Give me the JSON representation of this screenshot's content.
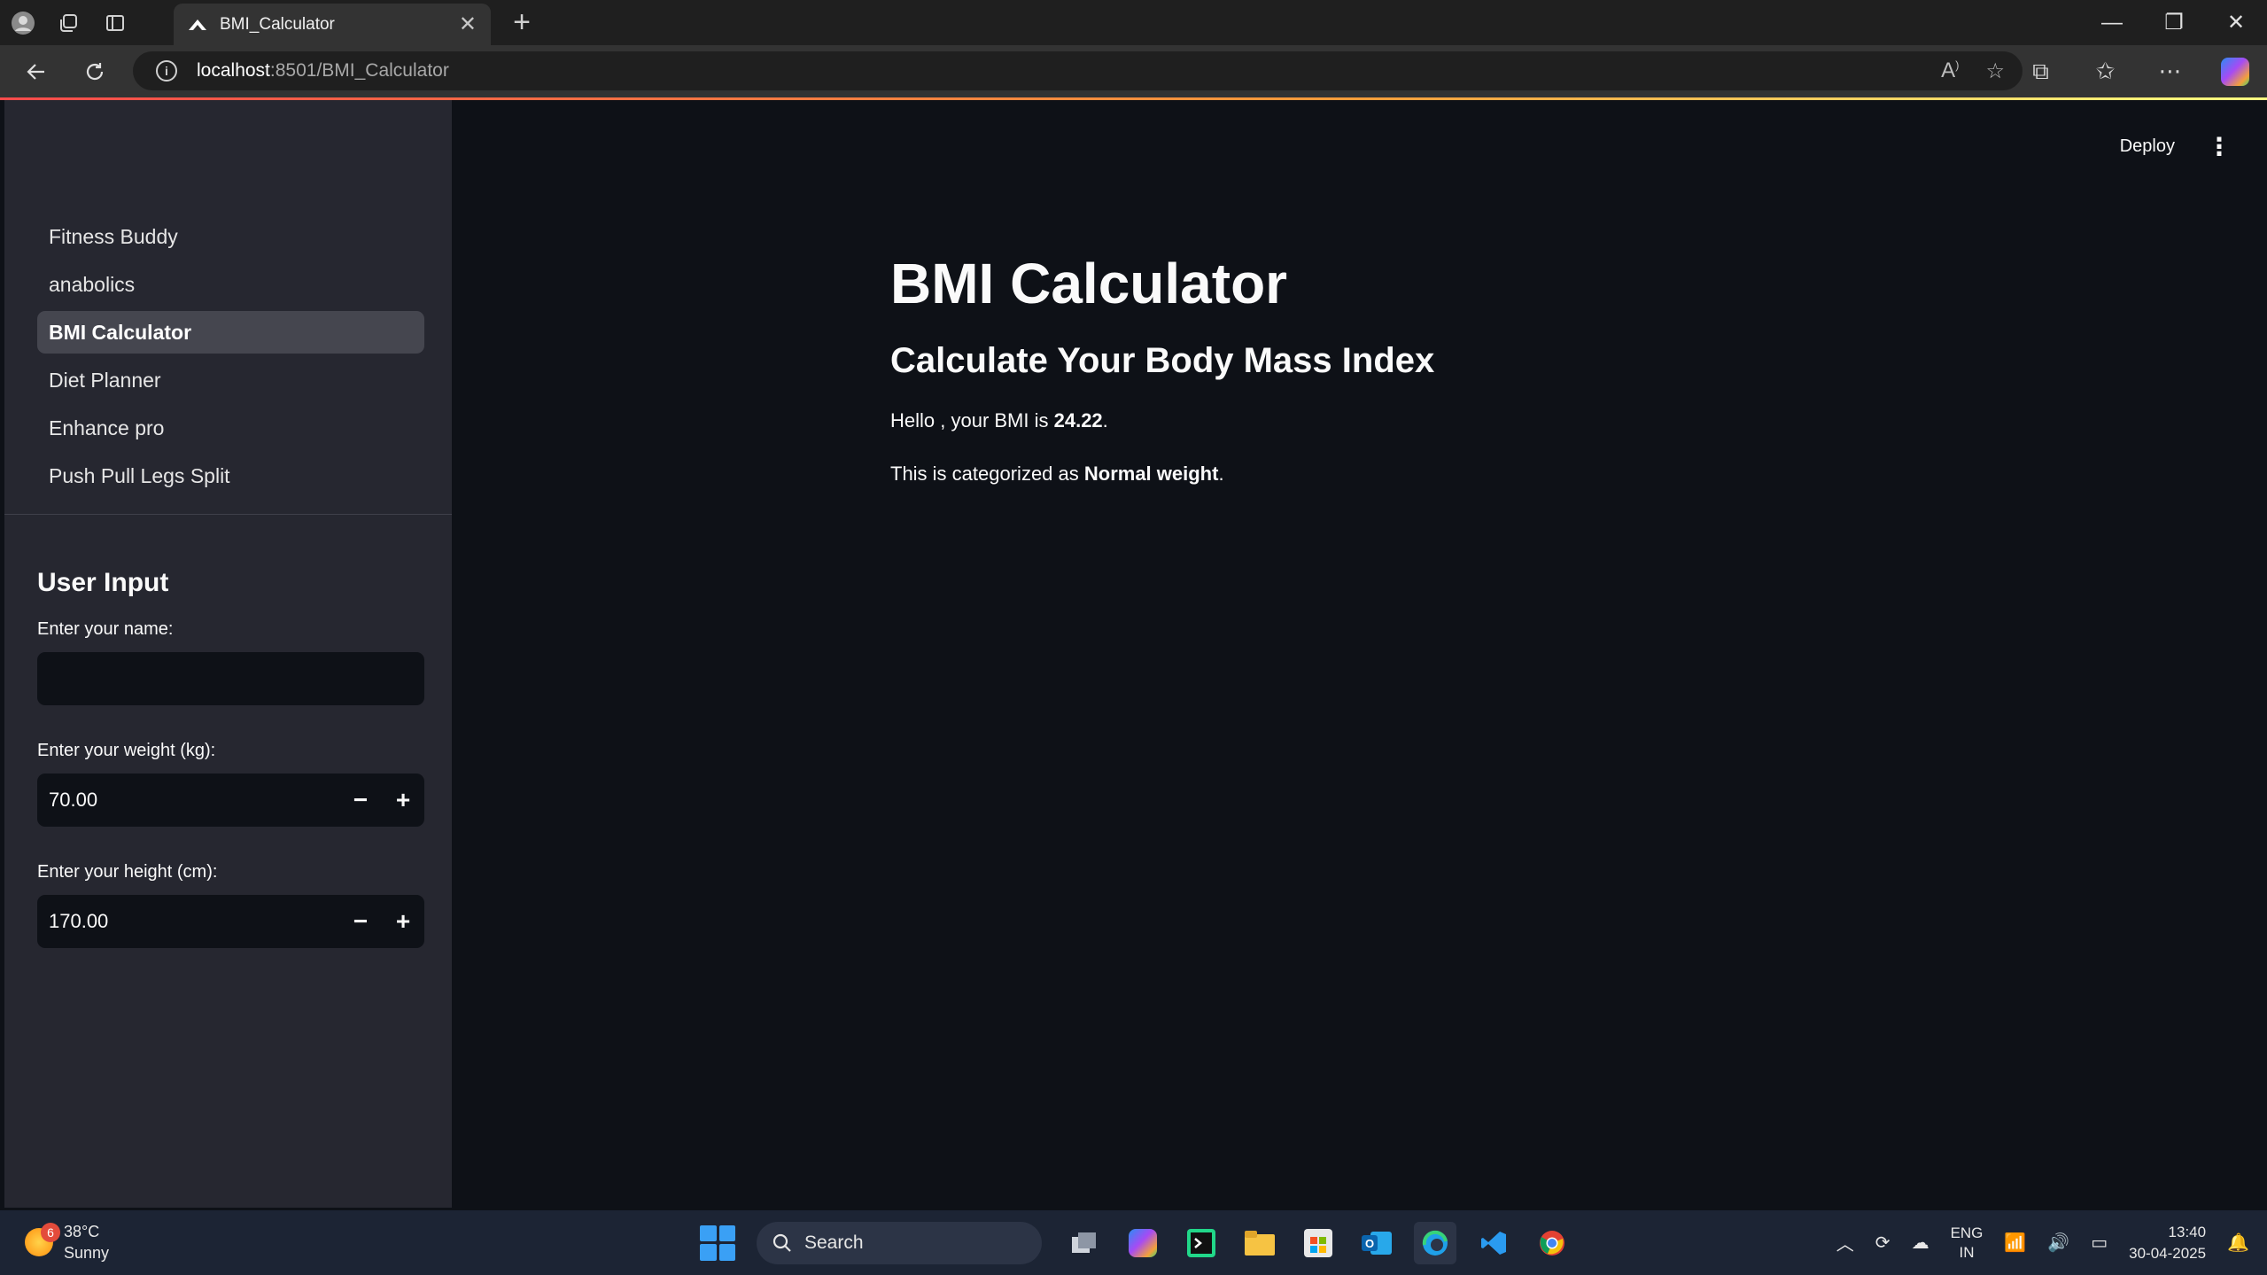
{
  "browser": {
    "tab_title": "BMI_Calculator",
    "url_host": "localhost",
    "url_rest": ":8501/BMI_Calculator"
  },
  "sidebar": {
    "nav_items": [
      {
        "label": "Fitness Buddy",
        "active": false
      },
      {
        "label": "anabolics",
        "active": false
      },
      {
        "label": "BMI Calculator",
        "active": true
      },
      {
        "label": "Diet Planner",
        "active": false
      },
      {
        "label": "Enhance pro",
        "active": false
      },
      {
        "label": "Push Pull Legs Split",
        "active": false
      }
    ],
    "section_title": "User Input",
    "name_label": "Enter your name:",
    "name_value": "",
    "weight_label": "Enter your weight (kg):",
    "weight_value": "70.00",
    "height_label": "Enter your height (cm):",
    "height_value": "170.00",
    "minus": "−",
    "plus": "+"
  },
  "main": {
    "deploy_label": "Deploy",
    "title": "BMI Calculator",
    "subheader": "Calculate Your Body Mass Index",
    "bmi_prefix": "Hello , your BMI is ",
    "bmi_value": "24.22",
    "bmi_suffix": ".",
    "category_prefix": "This is categorized as ",
    "category_value": "Normal weight",
    "category_suffix": "."
  },
  "taskbar": {
    "temperature": "38°C",
    "weather": "Sunny",
    "weather_badge": "6",
    "search_label": "Search",
    "lang_1": "ENG",
    "lang_2": "IN",
    "time": "13:40",
    "date": "30-04-2025"
  },
  "colors": {
    "background": "#0e1117",
    "sidebar": "#262730",
    "accent": "#ff4b4b"
  }
}
